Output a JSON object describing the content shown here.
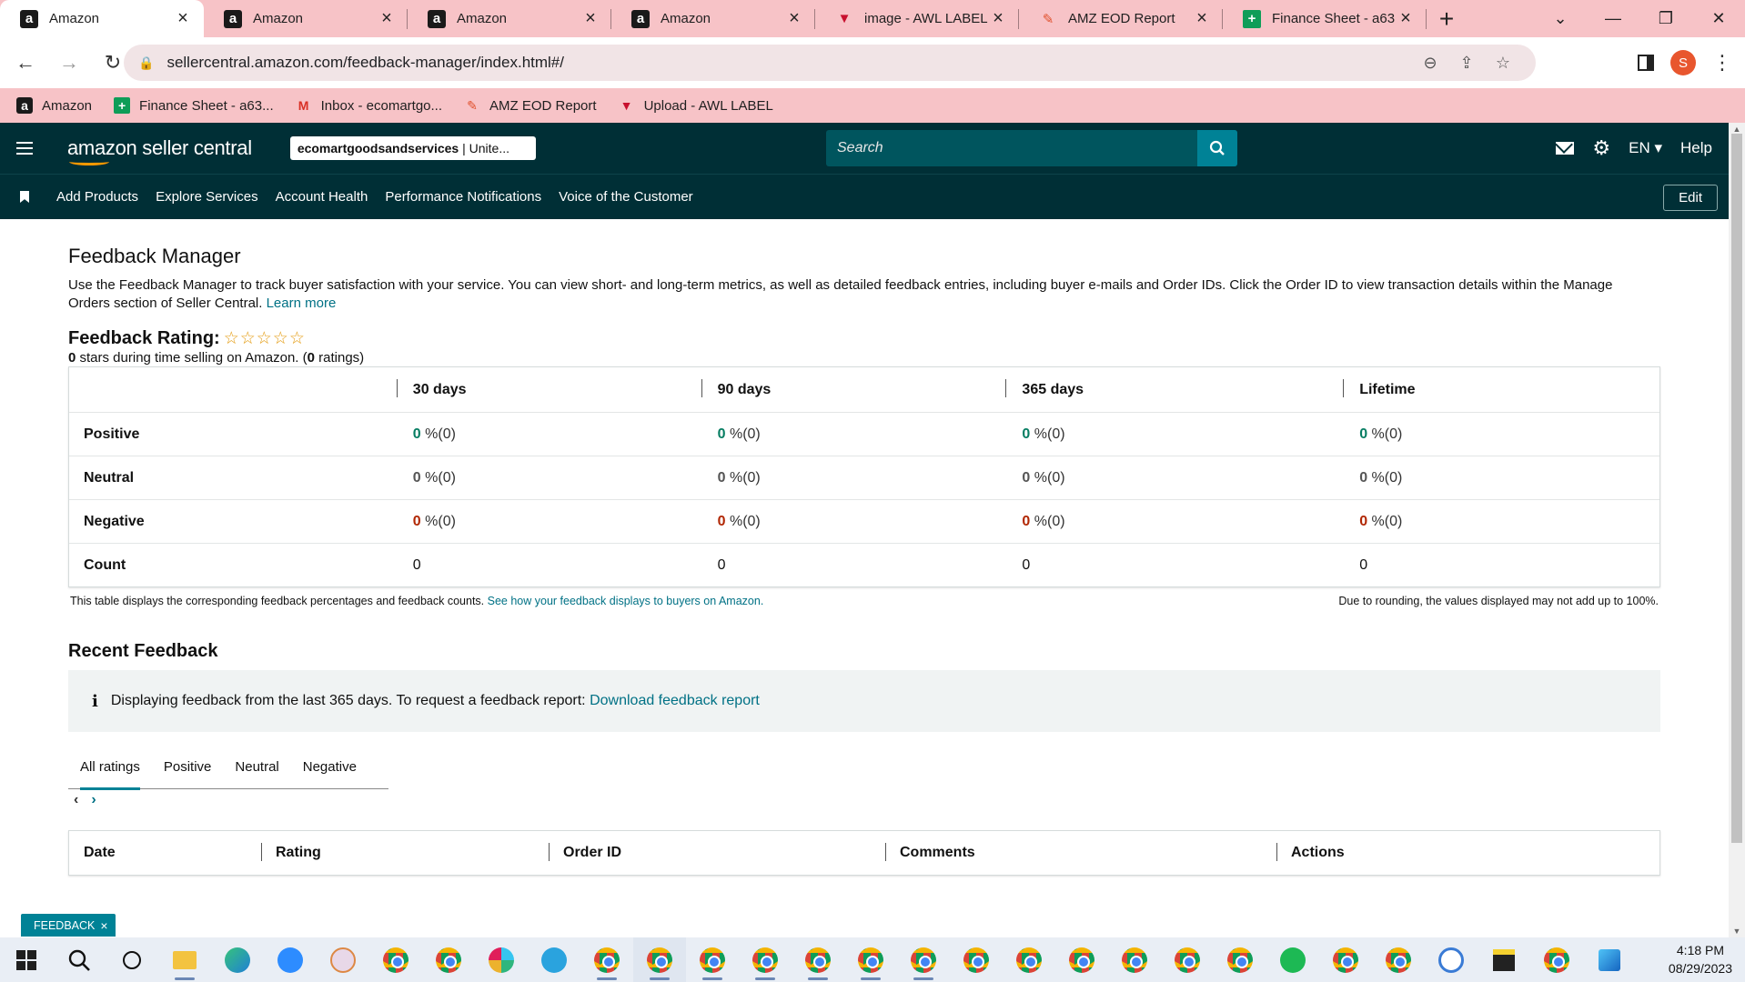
{
  "browser": {
    "tabs": [
      {
        "title": "Amazon",
        "icon": "amazon-icon",
        "active": true
      },
      {
        "title": "Amazon",
        "icon": "amazon-icon"
      },
      {
        "title": "Amazon",
        "icon": "amazon-icon"
      },
      {
        "title": "Amazon",
        "icon": "amazon-icon"
      },
      {
        "title": "image - AWL LABEL",
        "icon": "awl-icon"
      },
      {
        "title": "AMZ EOD Report",
        "icon": "eod-icon"
      },
      {
        "title": "Finance Sheet - a63",
        "icon": "sheets-icon"
      }
    ],
    "url": "sellercentral.amazon.com/feedback-manager/index.html#/",
    "profile_initial": "S",
    "bookmarks": [
      {
        "label": "Amazon",
        "icon": "amazon-icon"
      },
      {
        "label": "Finance Sheet - a63...",
        "icon": "sheets-icon"
      },
      {
        "label": "Inbox - ecomartgo...",
        "icon": "gmail-icon"
      },
      {
        "label": "AMZ EOD Report",
        "icon": "eod-icon"
      },
      {
        "label": "Upload - AWL LABEL",
        "icon": "awl-icon"
      }
    ]
  },
  "header": {
    "logo": "amazon seller central",
    "store_bold": "ecomartgoodsandservices",
    "store_rest": " | Unite...",
    "search_placeholder": "Search",
    "language": "EN",
    "help": "Help"
  },
  "nav": {
    "items": [
      "Add Products",
      "Explore Services",
      "Account Health",
      "Performance Notifications",
      "Voice of the Customer"
    ],
    "edit": "Edit"
  },
  "page": {
    "title": "Feedback Manager",
    "intro": "Use the Feedback Manager to track buyer satisfaction with your service. You can view short- and long-term metrics, as well as detailed feedback entries, including buyer e-mails and Order IDs. Click the Order ID to view transaction details within the Manage Orders section of Seller Central.",
    "learn_more": "Learn more",
    "rating_label": "Feedback Rating:",
    "stars": "☆☆☆☆☆",
    "stars_count": "0",
    "stars_text": " stars during time selling on Amazon. (",
    "ratings_count": "0",
    "ratings_text": " ratings)"
  },
  "rating_table": {
    "columns": [
      "30 days",
      "90 days",
      "365 days",
      "Lifetime"
    ],
    "rows": [
      {
        "label": "Positive",
        "cells": [
          {
            "n": "0",
            "p": " %(0)"
          },
          {
            "n": "0",
            "p": " %(0)"
          },
          {
            "n": "0",
            "p": " %(0)"
          },
          {
            "n": "0",
            "p": " %(0)"
          }
        ]
      },
      {
        "label": "Neutral",
        "cells": [
          {
            "n": "0",
            "p": " %(0)"
          },
          {
            "n": "0",
            "p": " %(0)"
          },
          {
            "n": "0",
            "p": " %(0)"
          },
          {
            "n": "0",
            "p": " %(0)"
          }
        ]
      },
      {
        "label": "Negative",
        "cells": [
          {
            "n": "0",
            "p": " %(0)"
          },
          {
            "n": "0",
            "p": " %(0)"
          },
          {
            "n": "0",
            "p": " %(0)"
          },
          {
            "n": "0",
            "p": " %(0)"
          }
        ]
      },
      {
        "label": "Count",
        "cells": [
          {
            "n": "0"
          },
          {
            "n": "0"
          },
          {
            "n": "0"
          },
          {
            "n": "0"
          }
        ]
      }
    ],
    "note": "This table displays the corresponding feedback percentages and feedback counts.",
    "note_link": "See how your feedback displays to buyers on Amazon.",
    "note_right": "Due to rounding, the values displayed may not add up to 100%."
  },
  "recent": {
    "title": "Recent Feedback",
    "info": "Displaying feedback from the last 365 days. To request a feedback report:",
    "info_link": "Download feedback report",
    "tabs": [
      "All ratings",
      "Positive",
      "Neutral",
      "Negative"
    ],
    "columns": [
      "Date",
      "Rating",
      "Order ID",
      "Comments",
      "Actions"
    ]
  },
  "feedback_pill": "FEEDBACK",
  "taskbar": {
    "time": "4:18 PM",
    "date": "08/29/2023"
  },
  "colors": {
    "header_bg": "#002f36",
    "search_bg": "#00555e",
    "accent": "#008296",
    "positive": "#067d62",
    "negative": "#b12704",
    "chrome_tint": "#f7c3c7"
  }
}
